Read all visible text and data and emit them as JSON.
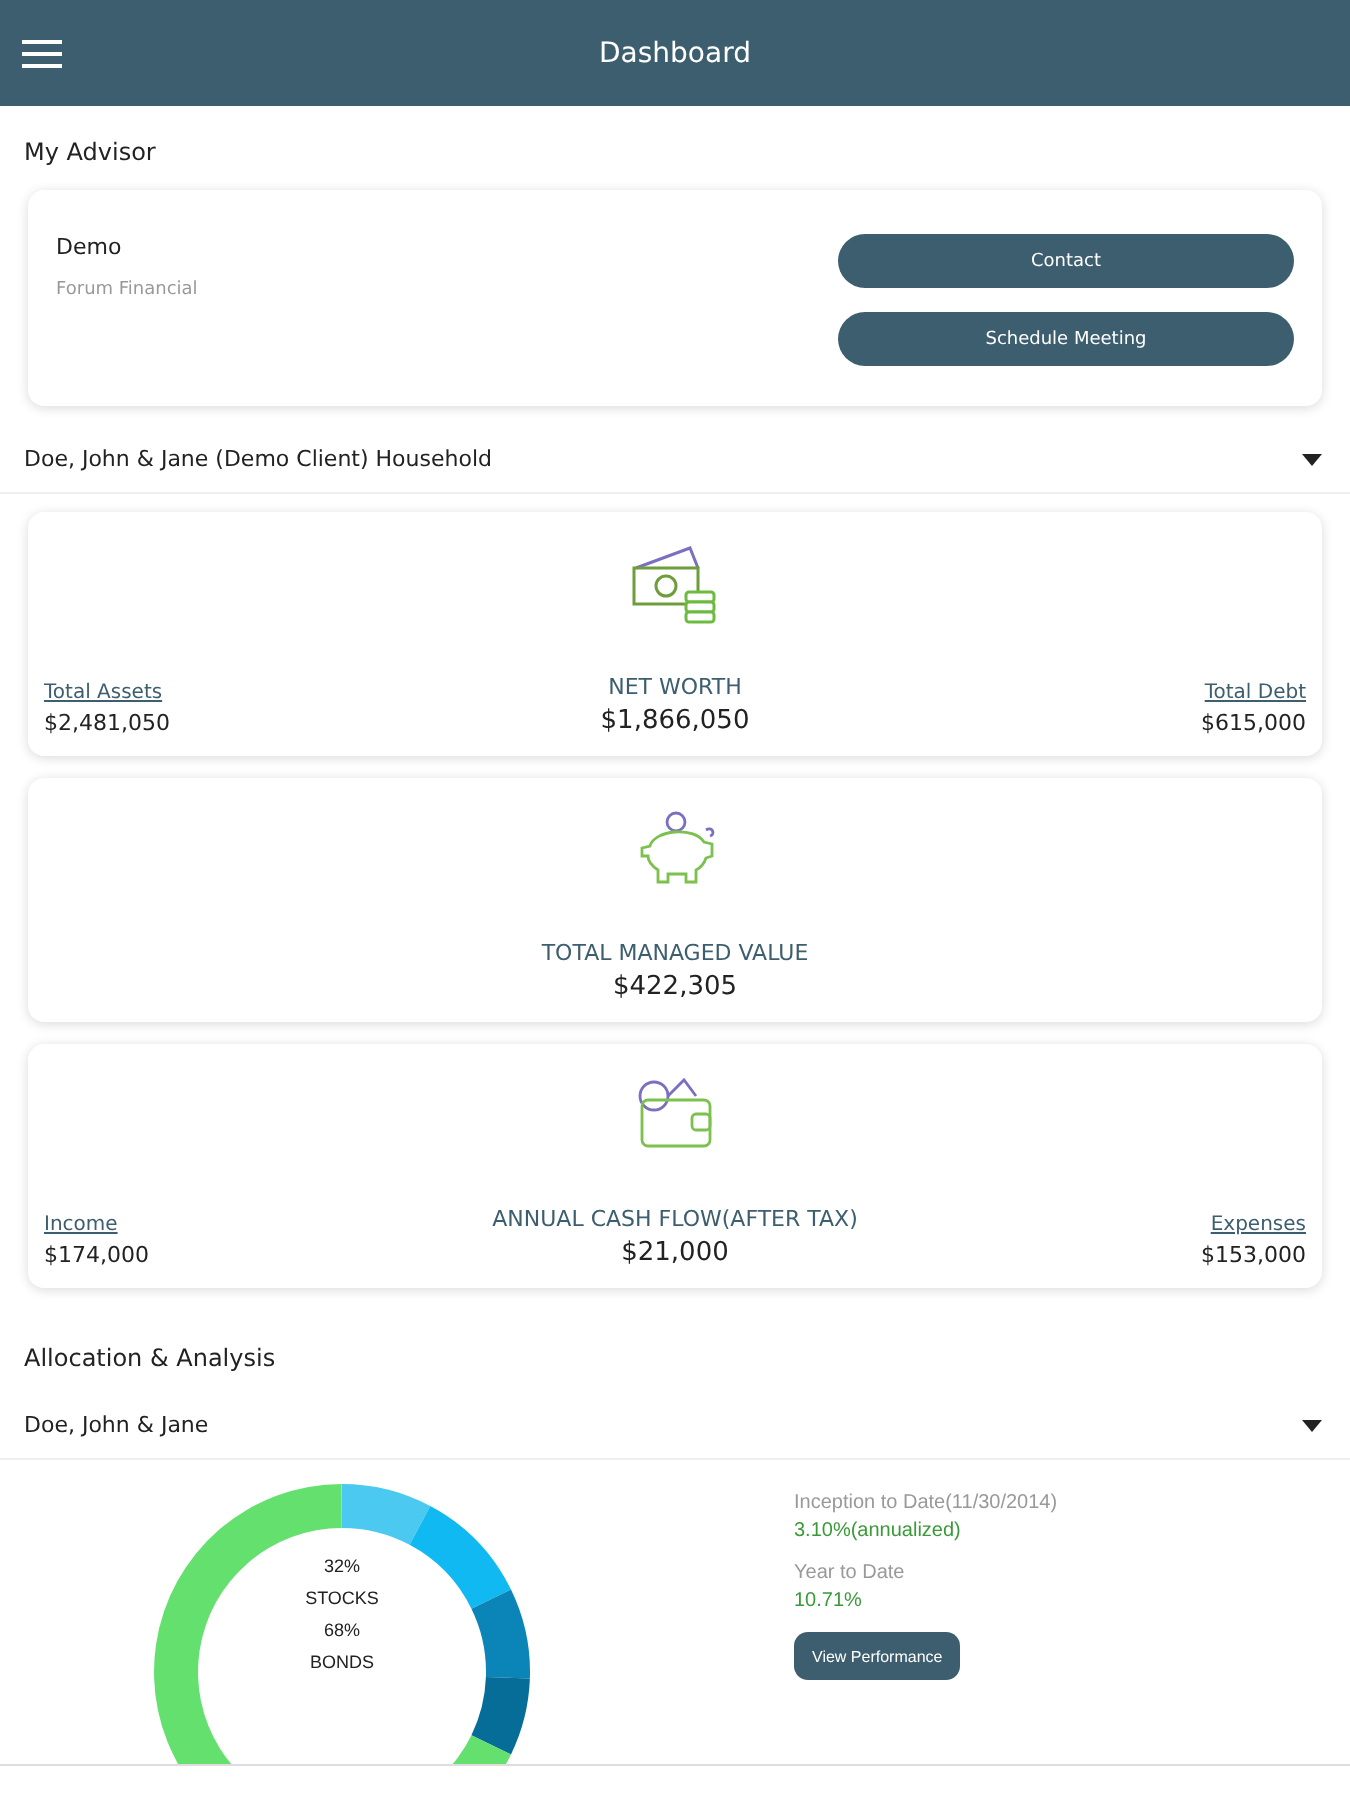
{
  "header": {
    "title": "Dashboard"
  },
  "advisor": {
    "heading": "My Advisor",
    "name": "Demo",
    "firm": "Forum Financial",
    "buttons": [
      "Contact",
      "Schedule Meeting"
    ]
  },
  "household": {
    "label": "Doe, John & Jane (Demo Client) Household"
  },
  "summary_cards": [
    {
      "kind": "cash",
      "title": "NET WORTH",
      "value": "$1,866,050",
      "left": {
        "label": "Total Assets",
        "value": "$2,481,050"
      },
      "right": {
        "label": "Total Debt",
        "value": "$615,000"
      }
    },
    {
      "kind": "piggy",
      "title": "TOTAL MANAGED VALUE",
      "value": "$422,305"
    },
    {
      "kind": "wallet",
      "title": "ANNUAL CASH FLOW(AFTER TAX)",
      "value": "$21,000",
      "left": {
        "label": "Income",
        "value": "$174,000"
      },
      "right": {
        "label": "Expenses",
        "value": "$153,000"
      }
    }
  ],
  "allocation": {
    "heading": "Allocation & Analysis",
    "account": "Doe, John & Jane",
    "donut_labels": [
      "32%",
      "STOCKS",
      "68%",
      "BONDS"
    ],
    "performance": [
      {
        "label": "Inception to Date(11/30/2014)",
        "value": "3.10%(annualized)"
      },
      {
        "label": "Year to Date",
        "value": "10.71%"
      }
    ],
    "button": "View Performance"
  }
}
